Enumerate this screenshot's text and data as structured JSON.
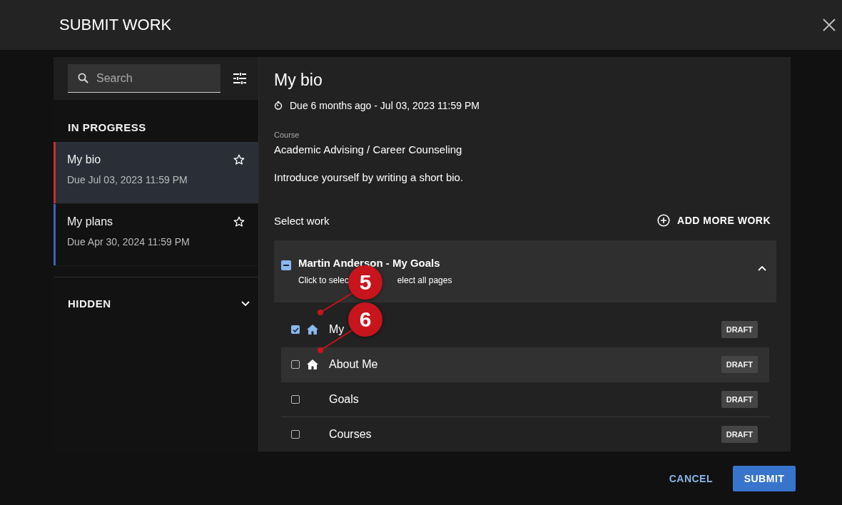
{
  "dialog": {
    "title": "SUBMIT WORK"
  },
  "sidebar": {
    "search": {
      "placeholder": "Search"
    },
    "sections": [
      {
        "title": "IN PROGRESS",
        "items": [
          {
            "title": "My bio",
            "due": "Due Jul 03, 2023 11:59 PM",
            "selected": true,
            "color": "#c62f2f"
          },
          {
            "title": "My plans",
            "due": "Due Apr 30, 2024 11:59 PM",
            "selected": false,
            "color": "#3a63b8"
          }
        ]
      },
      {
        "title": "HIDDEN",
        "expanded": false
      }
    ]
  },
  "detail": {
    "title": "My bio",
    "due": "Due 6 months ago - Jul 03, 2023 11:59 PM",
    "course_label": "Course",
    "course": "Academic Advising / Career Counseling",
    "description": "Introduce yourself by writing a short bio.",
    "select_label": "Select work",
    "add_button": "ADD MORE WORK",
    "group": {
      "title": "Martin Anderson - My Goals",
      "subtitle_parts": [
        "Click to selec",
        "elect all pages"
      ],
      "partially_selected": true,
      "expanded": true,
      "pages": [
        {
          "name": "My",
          "checked": true,
          "home": true,
          "highlighted": false,
          "status": "DRAFT"
        },
        {
          "name": "About Me",
          "checked": false,
          "home": true,
          "highlighted": true,
          "status": "DRAFT"
        },
        {
          "name": "Goals",
          "checked": false,
          "home": false,
          "highlighted": false,
          "status": "DRAFT"
        },
        {
          "name": "Courses",
          "checked": false,
          "home": false,
          "highlighted": false,
          "status": "DRAFT"
        }
      ]
    }
  },
  "annotations": [
    {
      "label": "5"
    },
    {
      "label": "6"
    }
  ],
  "footer": {
    "cancel": "CANCEL",
    "submit": "SUBMIT"
  }
}
